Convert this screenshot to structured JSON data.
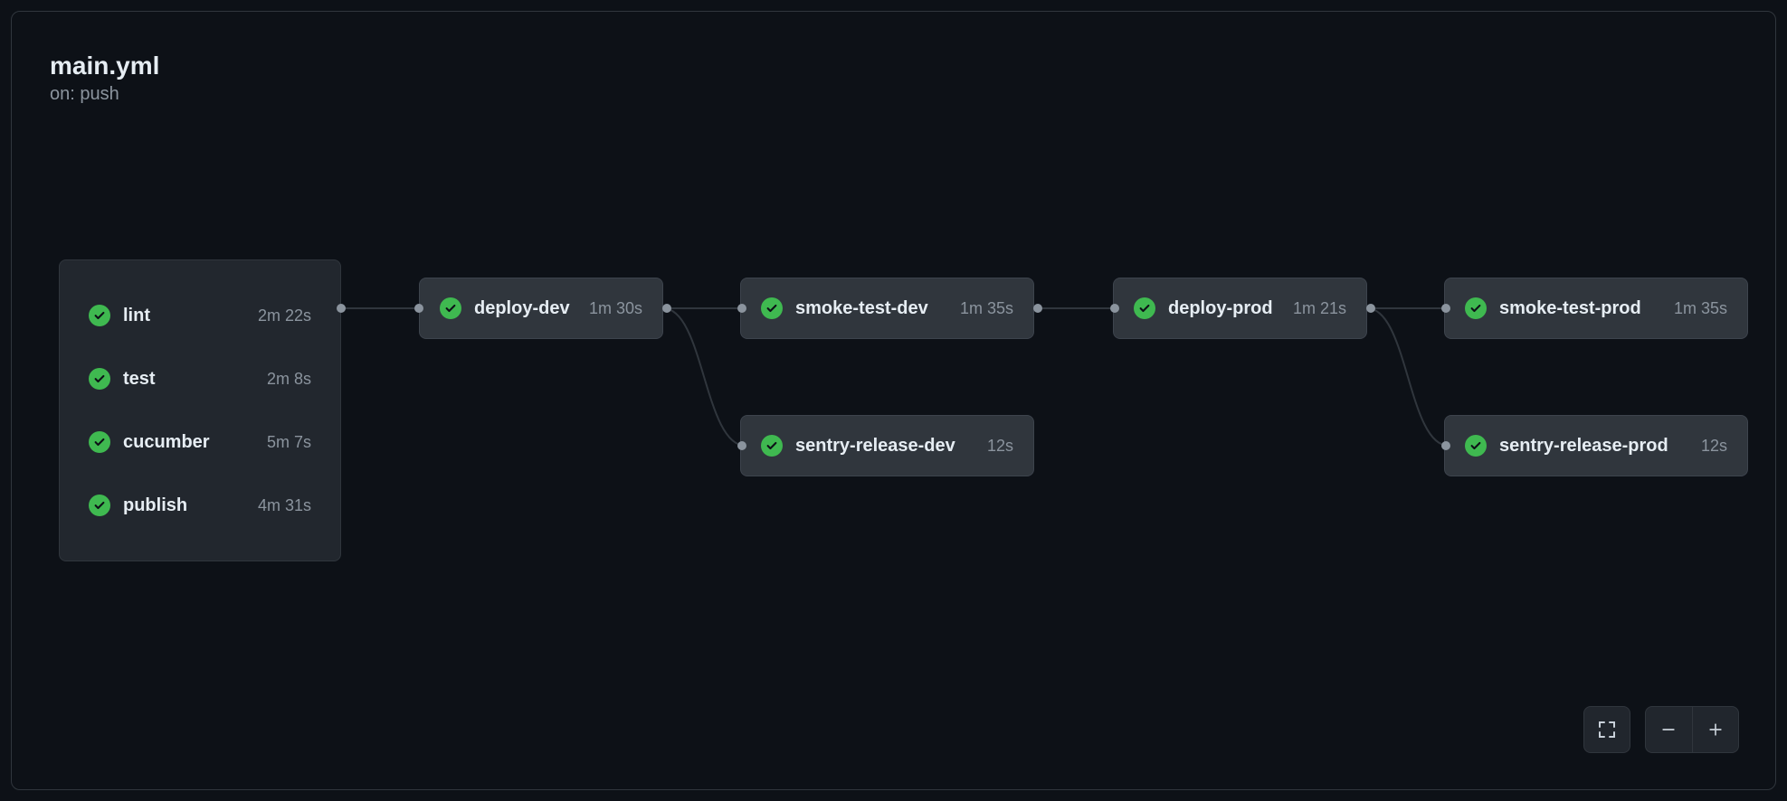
{
  "header": {
    "title": "main.yml",
    "trigger": "on: push"
  },
  "group": {
    "jobs": [
      {
        "name": "lint",
        "duration": "2m 22s",
        "status": "success"
      },
      {
        "name": "test",
        "duration": "2m 8s",
        "status": "success"
      },
      {
        "name": "cucumber",
        "duration": "5m 7s",
        "status": "success"
      },
      {
        "name": "publish",
        "duration": "4m 31s",
        "status": "success"
      }
    ]
  },
  "nodes": {
    "deploy_dev": {
      "label": "deploy-dev",
      "duration": "1m 30s",
      "status": "success"
    },
    "smoke_test_dev": {
      "label": "smoke-test-dev",
      "duration": "1m 35s",
      "status": "success"
    },
    "sentry_release_dev": {
      "label": "sentry-release-dev",
      "duration": "12s",
      "status": "success"
    },
    "deploy_prod": {
      "label": "deploy-prod",
      "duration": "1m 21s",
      "status": "success"
    },
    "smoke_test_prod": {
      "label": "smoke-test-prod",
      "duration": "1m 35s",
      "status": "success"
    },
    "sentry_release_prod": {
      "label": "sentry-release-prod",
      "duration": "12s",
      "status": "success"
    }
  },
  "colors": {
    "success": "#3fb950",
    "border": "#30363d",
    "muted": "#8b949e"
  }
}
